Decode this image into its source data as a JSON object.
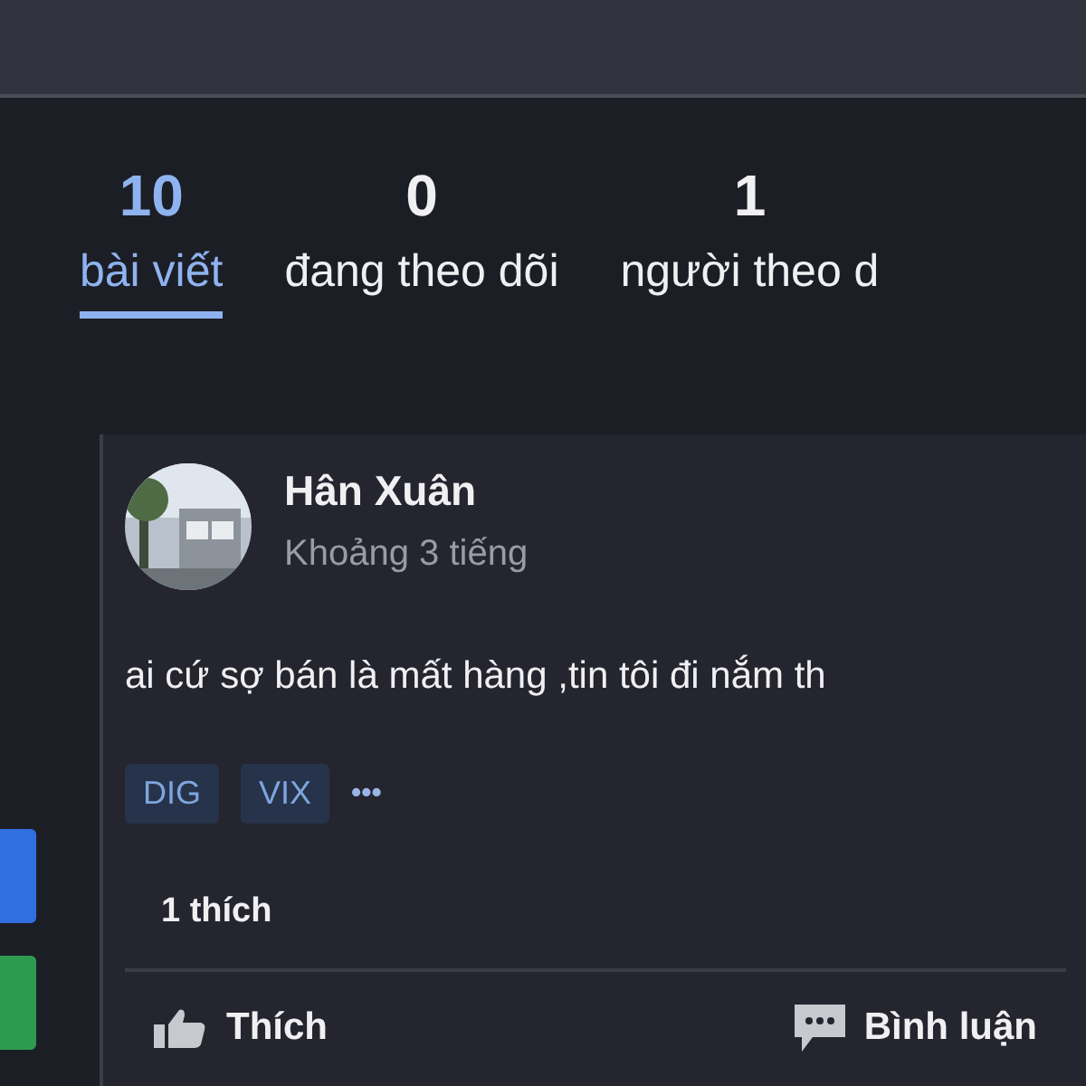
{
  "stats": [
    {
      "count": "10",
      "label": "bài viết",
      "selected": true
    },
    {
      "count": "0",
      "label": "đang theo dõi",
      "selected": false
    },
    {
      "count": "1",
      "label": "người theo d",
      "selected": false
    }
  ],
  "side_buttons": [
    {
      "color": "#2f6fe0"
    },
    {
      "color": "#2e9a4e"
    }
  ],
  "post": {
    "author": "Hân Xuân",
    "time": "Khoảng 3 tiếng",
    "avatar": {
      "kind": "picture"
    },
    "text": "ai cứ sợ bán là mất hàng ,tin tôi đi nắm th",
    "tags": [
      "DIG",
      "VIX"
    ],
    "more": "•••",
    "likes": "1 thích",
    "actions": [
      {
        "kind": "like",
        "label": "Thích"
      },
      {
        "kind": "comment",
        "label": "Bình luận"
      }
    ]
  }
}
